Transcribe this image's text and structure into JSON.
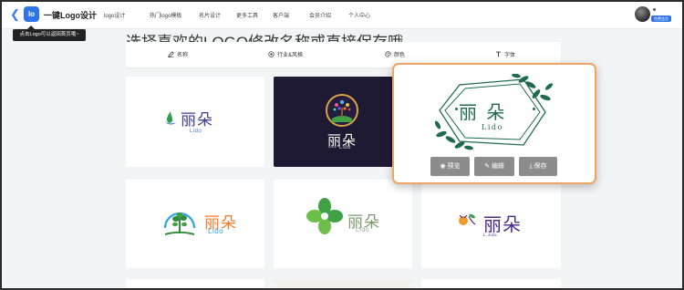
{
  "header": {
    "back_icon": "chevron-left-icon",
    "logo_mark": "lo",
    "brand": "一键Logo设计",
    "nav": [
      "logo设计",
      "热门logo模板",
      "名片设计",
      "更多工具",
      "客户端",
      "会员介绍",
      "个人中心"
    ],
    "user_badge": "免费会员",
    "accent_color": "#2f74e6"
  },
  "tooltip": "点击Logo可以返回首页哦~",
  "headline": "选择喜欢的LOGO修改名称或直接保存哦",
  "toolbar": {
    "items": [
      {
        "icon": "pen-icon",
        "label": "名称"
      },
      {
        "icon": "style-icon",
        "label": "行业&风格"
      },
      {
        "icon": "palette-icon",
        "label": "颜色"
      },
      {
        "icon": "font-icon",
        "label": "字体"
      }
    ]
  },
  "cards": [
    {
      "name": "丽朵",
      "sub": "Lido",
      "style": "blue-green",
      "colors": {
        "name": "#3c3c9c",
        "sub": "#4a78c2",
        "mark": "#2fa04a"
      }
    },
    {
      "name": "丽朵",
      "sub": "── Lido",
      "style": "dark-tree",
      "colors": {
        "name": "#ffffff",
        "sub": "#cccccc",
        "ring": "#d9a441"
      }
    },
    {
      "name": "丽朵",
      "sub": "Lido",
      "style": "orange-tree",
      "colors": {
        "name": "#f07d2b",
        "sub": "#2fa4dd",
        "mark": "#2f8c3a"
      }
    },
    {
      "name": "丽朵",
      "sub": "Lido",
      "style": "clover",
      "colors": {
        "name": "#7a9a6e",
        "sub": "#9aa89a",
        "mark": "#3fa044"
      }
    },
    {
      "name": "丽朵",
      "sub": "L.Jido",
      "style": "fruit",
      "colors": {
        "name": "#4a2a8c",
        "sub": "#4a2a8c",
        "mark": "#f29a2a"
      }
    }
  ],
  "featured": {
    "name": "丽 朵",
    "sub": "Lido",
    "color": "#1f6b4f",
    "actions": [
      {
        "icon": "eye-icon",
        "label": "预览"
      },
      {
        "icon": "edit-icon",
        "label": "编辑"
      },
      {
        "icon": "download-icon",
        "label": "保存"
      }
    ],
    "highlight_color": "#f0a463"
  }
}
